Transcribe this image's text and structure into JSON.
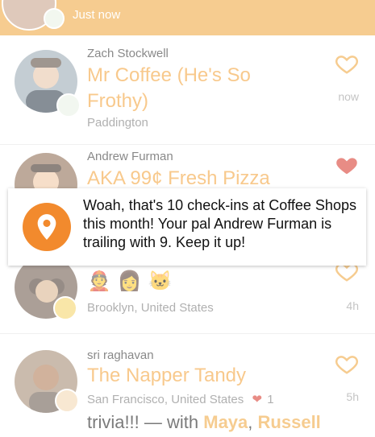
{
  "colors": {
    "accent": "#f0a840",
    "notification_pin": "#f28a2d",
    "liked_heart": "#d83a2e"
  },
  "top_card": {
    "time": "Just now"
  },
  "feed": [
    {
      "name": "Zach Stockwell",
      "venue": "Mr Coffee (He's So Frothy)",
      "location": "Paddington",
      "time": "now",
      "liked": false
    },
    {
      "name": "Andrew Furman",
      "venue": "AKA 99¢ Fresh Pizza",
      "liked": true
    },
    {
      "location": "Brooklyn, United States",
      "time": "4h",
      "liked": false
    },
    {
      "name": "sri raghavan",
      "venue": "The Napper Tandy",
      "location": "San Francisco, United States",
      "likes": "1",
      "time": "5h",
      "liked": false,
      "comment_prefix": "trivia!!! — with ",
      "comment_user1": "Maya",
      "comment_sep": ", ",
      "comment_user2": "Russell"
    }
  ],
  "notification": {
    "icon": "location-pin-icon",
    "text": "Woah, that's 10 check-ins at Coffee Shops this month! Your pal Andrew Furman is trailing with 9. Keep it up!"
  }
}
